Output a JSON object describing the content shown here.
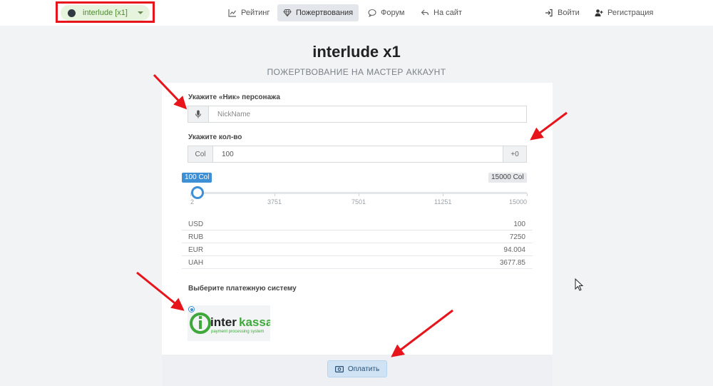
{
  "nav": {
    "server": "interlude [x1]",
    "items": [
      {
        "label": "Рейтинг",
        "icon": "chart-icon"
      },
      {
        "label": "Пожертвования",
        "icon": "diamond-icon"
      },
      {
        "label": "Форум",
        "icon": "chat-icon"
      },
      {
        "label": "На сайт",
        "icon": "back-arrow-icon"
      }
    ],
    "login": "Войти",
    "register": "Регистрация"
  },
  "page": {
    "title": "interlude x1",
    "subtitle": "ПОЖЕРТВОВАНИЕ НА МАСТЕР АККАУНТ"
  },
  "form": {
    "nick_label": "Укажите «Ник» персонажа",
    "nick_placeholder": "NickName",
    "amount_label": "Укажите кол-во",
    "amount_prefix": "Col",
    "amount_value": "100",
    "amount_suffix": "+0",
    "slider": {
      "current_label": "100 Col",
      "max_label": "15000 Col",
      "min": 2,
      "max": 15000,
      "value": 100,
      "ticks": [
        "2",
        "3751",
        "7501",
        "11251",
        "15000"
      ]
    },
    "rates": [
      {
        "currency": "USD",
        "value": "100"
      },
      {
        "currency": "RUB",
        "value": "7250"
      },
      {
        "currency": "EUR",
        "value": "94.004"
      },
      {
        "currency": "UAH",
        "value": "3677.85"
      }
    ],
    "payment_label": "Выберите платежную систему",
    "payment_system": {
      "name_a": "inter",
      "name_b": "kassa",
      "tagline": "payment processing system"
    },
    "pay_button": "Оплатить"
  },
  "colors": {
    "accent": "#3d8fd6",
    "annotation": "#e8141c",
    "interkassa_green": "#3ea83b"
  }
}
